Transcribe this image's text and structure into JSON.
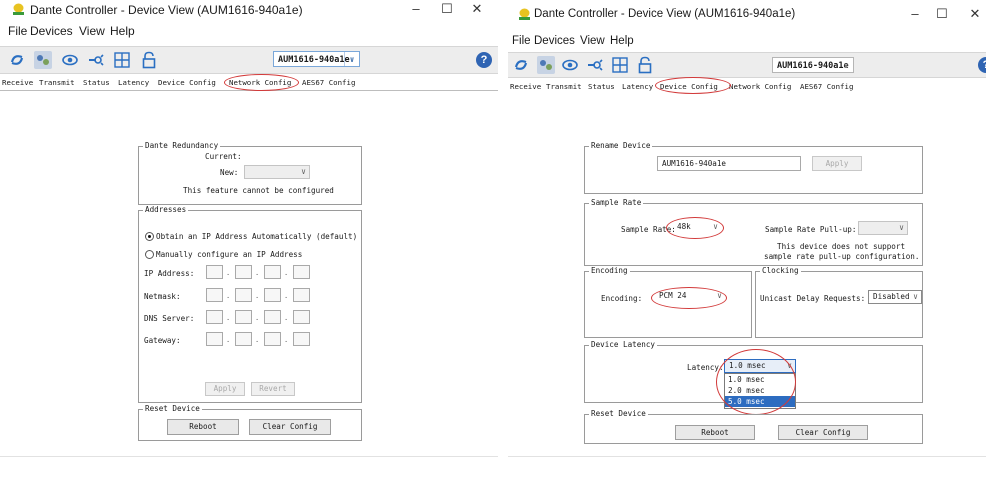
{
  "left": {
    "title": "Dante Controller - Device View (AUM1616-940a1e)",
    "menu": [
      "File",
      "Devices",
      "View",
      "Help"
    ],
    "device_select": "AUM1616-940a1e",
    "tabs": [
      "Receive",
      "Transmit",
      "Status",
      "Latency",
      "Device Config",
      "Network Config",
      "AES67 Config"
    ],
    "highlighted_tab": "Network Config",
    "redundancy": {
      "title": "Dante Redundancy",
      "current_label": "Current:",
      "new_label": "New:",
      "note": "This feature cannot be configured"
    },
    "addresses": {
      "title": "Addresses",
      "auto_option": "Obtain an IP Address Automatically (default)",
      "manual_option": "Manually configure an IP Address",
      "fields": [
        "IP Address:",
        "Netmask:",
        "DNS Server:",
        "Gateway:"
      ],
      "apply": "Apply",
      "revert": "Revert"
    },
    "reset": {
      "title": "Reset Device",
      "reboot": "Reboot",
      "clear": "Clear Config"
    }
  },
  "right": {
    "title": "Dante Controller - Device View (AUM1616-940a1e)",
    "menu": [
      "File",
      "Devices",
      "View",
      "Help"
    ],
    "device_select": "AUM1616-940a1e",
    "tabs": [
      "Receive",
      "Transmit",
      "Status",
      "Latency",
      "Device Config",
      "Network Config",
      "AES67 Config"
    ],
    "highlighted_tab": "Device Config",
    "rename": {
      "title": "Rename Device",
      "value": "AUM1616-940a1e",
      "apply": "Apply"
    },
    "sample_rate": {
      "title": "Sample Rate",
      "label": "Sample Rate:",
      "value": "48k",
      "pullup_label": "Sample Rate Pull-up:",
      "note1": "This device does not support",
      "note2": "sample rate pull-up configuration."
    },
    "encoding": {
      "title": "Encoding",
      "label": "Encoding:",
      "value": "PCM 24"
    },
    "clocking": {
      "title": "Clocking",
      "label": "Unicast Delay Requests:",
      "value": "Disabled"
    },
    "latency": {
      "title": "Device Latency",
      "label": "Latency:",
      "value": "1.0 msec",
      "options": [
        "1.0 msec",
        "2.0 msec",
        "5.0 msec"
      ],
      "highlighted_option": "5.0 msec"
    },
    "reset": {
      "title": "Reset Device",
      "reboot": "Reboot",
      "clear": "Clear Config"
    }
  },
  "colors": {
    "annotation": "#d23a3a",
    "selection": "#2d6cc0",
    "help": "#2f64b3"
  },
  "icons": [
    "dante-logo-icon",
    "minimize-icon",
    "maximize-icon",
    "close-icon",
    "refresh-icon",
    "network-view-icon",
    "eye-icon",
    "connect-icon",
    "grid-icon",
    "lock-icon",
    "help-icon",
    "dropdown-arrow-icon"
  ]
}
